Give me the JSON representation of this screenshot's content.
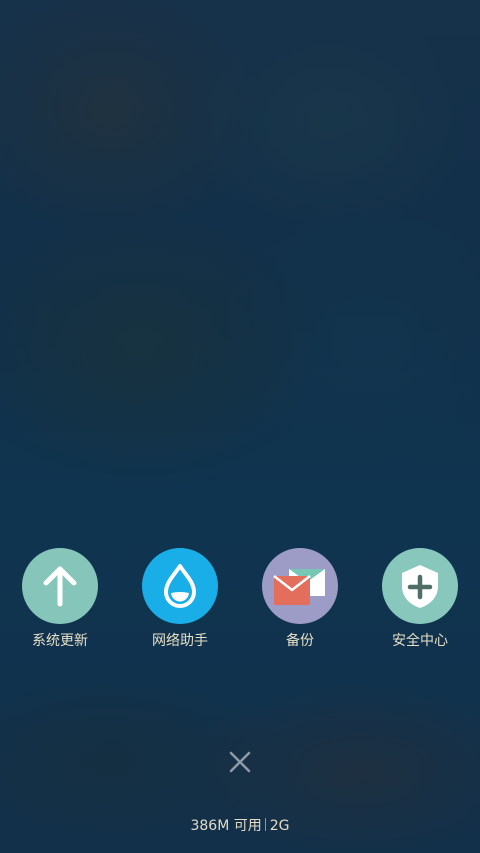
{
  "colors": {
    "system_update_bg": "#86c5b9",
    "network_assistant_bg": "#1aaee8",
    "backup_bg": "#9d9cc6",
    "security_center_bg": "#88c7bc",
    "label_text": "#e6e0c6",
    "close_icon": "#8d9aa6"
  },
  "shortcuts": [
    {
      "label": "系统更新",
      "icon": "arrow-up-icon"
    },
    {
      "label": "网络助手",
      "icon": "water-drop-icon"
    },
    {
      "label": "备份",
      "icon": "envelope-icon"
    },
    {
      "label": "安全中心",
      "icon": "shield-plus-icon"
    }
  ],
  "close": {
    "icon": "close-icon"
  },
  "status": {
    "memory": "386M 可用",
    "network": "2G"
  }
}
